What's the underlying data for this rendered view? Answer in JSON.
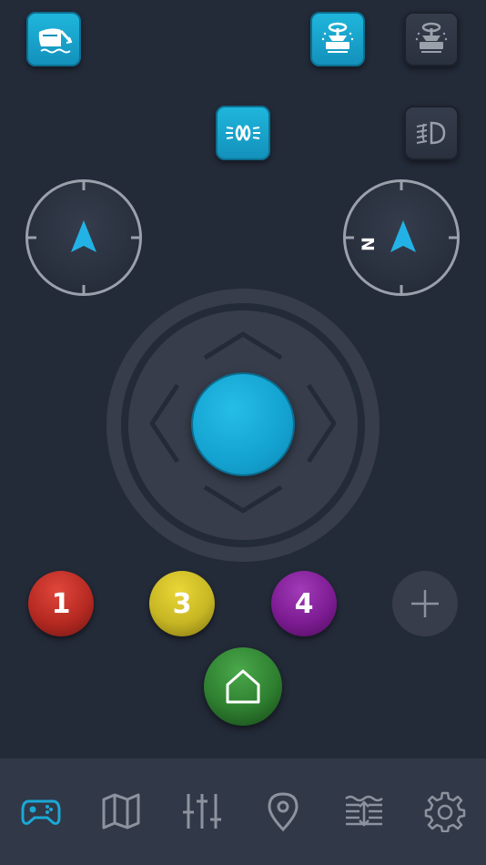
{
  "colors": {
    "background": "#232a38",
    "accent": "#1ba9d6",
    "tab_active": "#1ba9d6",
    "tab_inactive": "#8d939e",
    "tabbar": "#313848"
  },
  "top_controls": [
    {
      "icon": "boat-trim-icon",
      "state": "active"
    },
    {
      "icon": "anchor-winch-active-icon",
      "state": "active"
    },
    {
      "icon": "anchor-winch-inactive-icon",
      "state": "inactive"
    },
    {
      "icon": "nav-lights-icon",
      "state": "active"
    },
    {
      "icon": "fog-light-icon",
      "state": "inactive"
    }
  ],
  "compasses": [
    {
      "icon": "heading-arrow-icon",
      "label": ""
    },
    {
      "icon": "north-arrow-icon",
      "label": "N"
    }
  ],
  "joystick": {
    "knob": "joystick-knob"
  },
  "waypoints": [
    {
      "label": "1",
      "color": "#b62a22"
    },
    {
      "label": "3",
      "color": "#c8b724"
    },
    {
      "label": "4",
      "color": "#7d1c93"
    }
  ],
  "home": {
    "icon": "home-icon"
  },
  "tabs": [
    {
      "icon": "gamepad-icon",
      "active": true
    },
    {
      "icon": "map-icon",
      "active": false
    },
    {
      "icon": "sliders-icon",
      "active": false
    },
    {
      "icon": "location-pin-icon",
      "active": false
    },
    {
      "icon": "depth-icon",
      "active": false
    },
    {
      "icon": "settings-gear-icon",
      "active": false
    }
  ]
}
